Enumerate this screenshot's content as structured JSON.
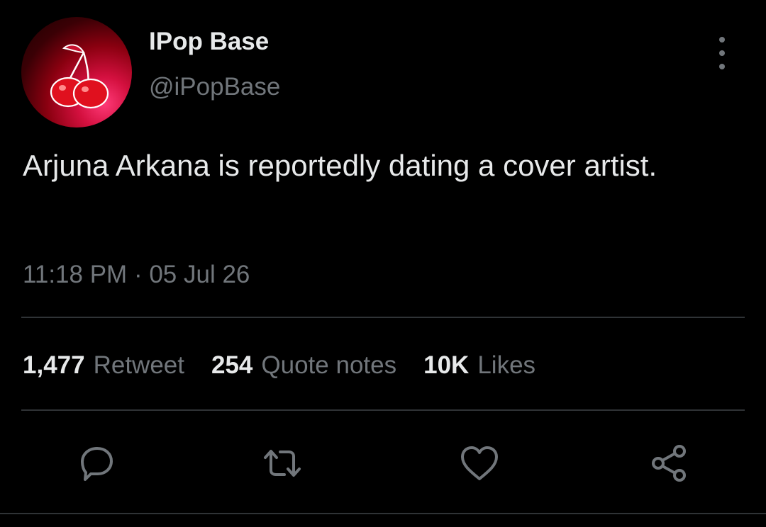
{
  "account": {
    "display_name": "IPop Base",
    "handle": "@iPopBase",
    "avatar_icon": "cherry-icon"
  },
  "tweet": {
    "text": "Arjuna Arkana is reportedly dating a cover artist.",
    "time": "11:18 PM",
    "separator": "·",
    "date": "05 Jul 26"
  },
  "stats": {
    "retweets": {
      "count": "1,477",
      "label": "Retweet"
    },
    "quotes": {
      "count": "254",
      "label": "Quote notes"
    },
    "likes": {
      "count": "10K",
      "label": "Likes"
    }
  },
  "actions": [
    {
      "name": "reply",
      "icon": "speech-bubble-icon"
    },
    {
      "name": "retweet",
      "icon": "retweet-arrows-icon"
    },
    {
      "name": "like",
      "icon": "heart-icon"
    },
    {
      "name": "share",
      "icon": "share-nodes-icon"
    }
  ],
  "colors": {
    "background": "#000000",
    "primary_text": "#e7e9ea",
    "secondary_text": "#71767b",
    "divider": "#2f3336",
    "avatar_accent": "#d4103f"
  }
}
